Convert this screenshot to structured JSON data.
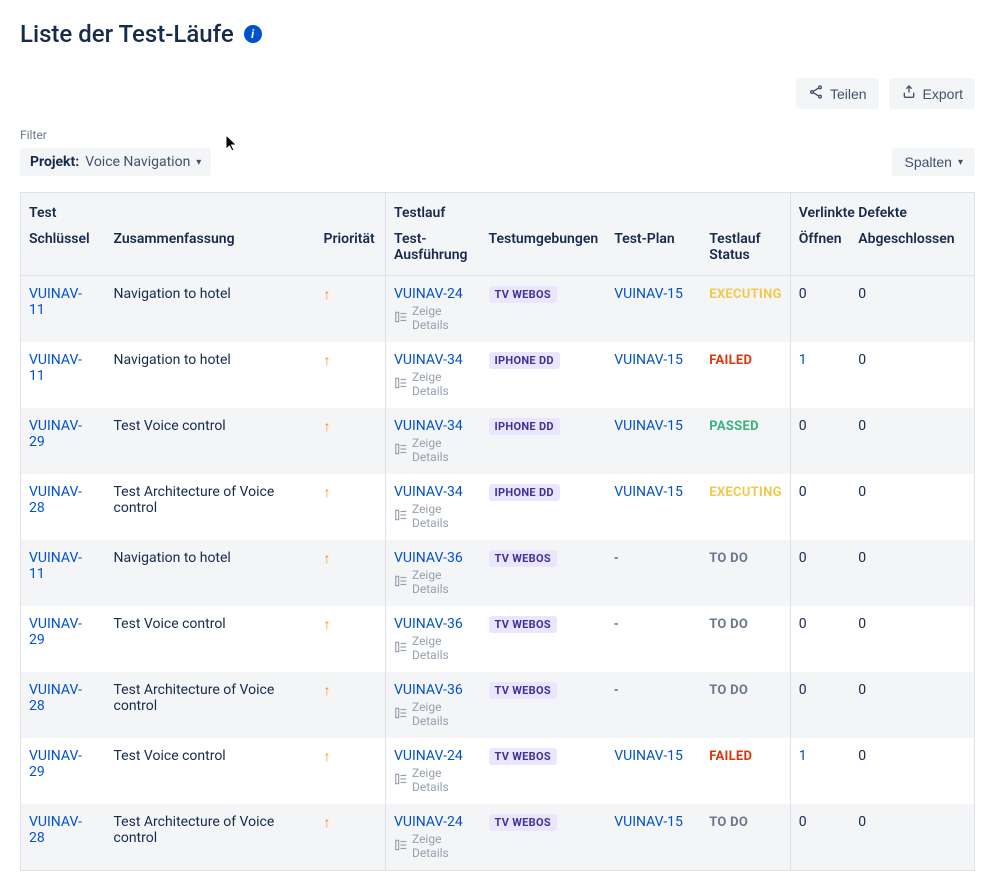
{
  "header": {
    "title": "Liste der Test-Läufe"
  },
  "toolbar": {
    "share_label": "Teilen",
    "export_label": "Export"
  },
  "filter": {
    "label": "Filter",
    "key": "Projekt:",
    "value": "Voice Navigation"
  },
  "columns_button": "Spalten",
  "table": {
    "group_headers": {
      "test": "Test",
      "run": "Testlauf",
      "defects": "Verlinkte Defekte"
    },
    "sub_headers": {
      "key": "Schlüssel",
      "summary": "Zusammenfassung",
      "priority": "Priorität",
      "execution": "Test-Ausführung",
      "environments": "Testumgebungen",
      "plan": "Test-Plan",
      "status": "Testlauf Status",
      "open": "Öffnen",
      "done": "Abgeschlossen"
    },
    "details_label": "Zeige Details",
    "rows": [
      {
        "key": "VUINAV-11",
        "summary": "Navigation to hotel",
        "exec": "VUINAV-24",
        "env": "TV WEBOS",
        "plan": "VUINAV-15",
        "status": "EXECUTING",
        "status_cls": "EXECUTING",
        "open": "0",
        "done": "0",
        "open_link": false
      },
      {
        "key": "VUINAV-11",
        "summary": "Navigation to hotel",
        "exec": "VUINAV-34",
        "env": "IPHONE DD",
        "plan": "VUINAV-15",
        "status": "FAILED",
        "status_cls": "FAILED",
        "open": "1",
        "done": "0",
        "open_link": true
      },
      {
        "key": "VUINAV-29",
        "summary": "Test Voice control",
        "exec": "VUINAV-34",
        "env": "IPHONE DD",
        "plan": "VUINAV-15",
        "status": "PASSED",
        "status_cls": "PASSED",
        "open": "0",
        "done": "0",
        "open_link": false
      },
      {
        "key": "VUINAV-28",
        "summary": "Test Architecture of Voice control",
        "exec": "VUINAV-34",
        "env": "IPHONE DD",
        "plan": "VUINAV-15",
        "status": "EXECUTING",
        "status_cls": "EXECUTING",
        "open": "0",
        "done": "0",
        "open_link": false
      },
      {
        "key": "VUINAV-11",
        "summary": "Navigation to hotel",
        "exec": "VUINAV-36",
        "env": "TV WEBOS",
        "plan": "-",
        "status": "TO DO",
        "status_cls": "TODO",
        "open": "0",
        "done": "0",
        "open_link": false
      },
      {
        "key": "VUINAV-29",
        "summary": "Test Voice control",
        "exec": "VUINAV-36",
        "env": "TV WEBOS",
        "plan": "-",
        "status": "TO DO",
        "status_cls": "TODO",
        "open": "0",
        "done": "0",
        "open_link": false
      },
      {
        "key": "VUINAV-28",
        "summary": "Test Architecture of Voice control",
        "exec": "VUINAV-36",
        "env": "TV WEBOS",
        "plan": "-",
        "status": "TO DO",
        "status_cls": "TODO",
        "open": "0",
        "done": "0",
        "open_link": false
      },
      {
        "key": "VUINAV-29",
        "summary": "Test Voice control",
        "exec": "VUINAV-24",
        "env": "TV WEBOS",
        "plan": "VUINAV-15",
        "status": "FAILED",
        "status_cls": "FAILED",
        "open": "1",
        "done": "0",
        "open_link": true
      },
      {
        "key": "VUINAV-28",
        "summary": "Test Architecture of Voice control",
        "exec": "VUINAV-24",
        "env": "TV WEBOS",
        "plan": "VUINAV-15",
        "status": "TO DO",
        "status_cls": "TODO",
        "open": "0",
        "done": "0",
        "open_link": false
      }
    ]
  }
}
